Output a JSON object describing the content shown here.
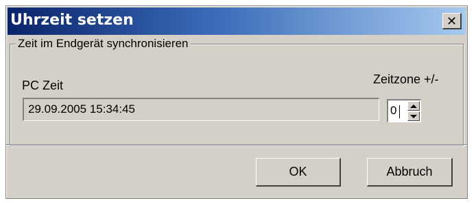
{
  "window": {
    "title": "Uhrzeit setzen",
    "close_symbol": "✕"
  },
  "group": {
    "legend": "Zeit im Endgerät synchronisieren",
    "pc_time_label": "PC Zeit",
    "pc_time_value": "29.09.2005 15:34:45",
    "timezone_label": "Zeitzone +/-",
    "timezone_value": "0"
  },
  "buttons": {
    "ok_label": "OK",
    "cancel_label": "Abbruch"
  },
  "icons": {
    "close": "close-icon",
    "spin_up": "arrow-up-icon",
    "spin_down": "arrow-down-icon"
  },
  "colors": {
    "titlebar_start": "#0a246a",
    "titlebar_end": "#a6caf0",
    "face": "#d4d0c8"
  }
}
